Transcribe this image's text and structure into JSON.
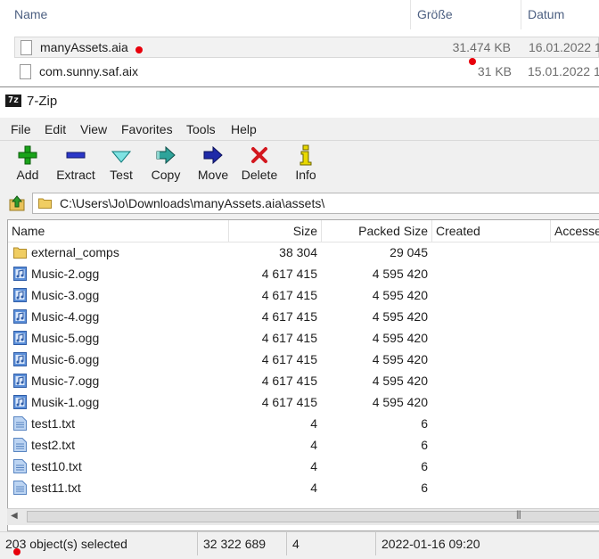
{
  "explorer": {
    "columns": {
      "name": "Name",
      "size": "Größe",
      "date": "Datum"
    },
    "rows": [
      {
        "name": "manyAssets.aia",
        "size": "31.474 KB",
        "date": "16.01.2022 1"
      },
      {
        "name": "com.sunny.saf.aix",
        "size": "31 KB",
        "date": "15.01.2022 1"
      }
    ]
  },
  "window": {
    "title": "7-Zip",
    "app_icon": "7z"
  },
  "menu": [
    "File",
    "Edit",
    "View",
    "Favorites",
    "Tools",
    "Help"
  ],
  "toolbar": {
    "add": "Add",
    "extract": "Extract",
    "test": "Test",
    "copy": "Copy",
    "move": "Move",
    "delete": "Delete",
    "info": "Info"
  },
  "address": {
    "path": "C:\\Users\\Jo\\Downloads\\manyAssets.aia\\assets\\"
  },
  "list": {
    "columns": {
      "name": "Name",
      "size": "Size",
      "packed": "Packed Size",
      "created": "Created",
      "accessed": "Accesse"
    },
    "rows": [
      {
        "name": "external_comps",
        "size": "38 304",
        "packed": "29 045",
        "icon": "folder-icon"
      },
      {
        "name": "Music-2.ogg",
        "size": "4 617 415",
        "packed": "4 595 420",
        "icon": "audio-file-icon"
      },
      {
        "name": "Music-3.ogg",
        "size": "4 617 415",
        "packed": "4 595 420",
        "icon": "audio-file-icon"
      },
      {
        "name": "Music-4.ogg",
        "size": "4 617 415",
        "packed": "4 595 420",
        "icon": "audio-file-icon"
      },
      {
        "name": "Music-5.ogg",
        "size": "4 617 415",
        "packed": "4 595 420",
        "icon": "audio-file-icon"
      },
      {
        "name": "Music-6.ogg",
        "size": "4 617 415",
        "packed": "4 595 420",
        "icon": "audio-file-icon"
      },
      {
        "name": "Music-7.ogg",
        "size": "4 617 415",
        "packed": "4 595 420",
        "icon": "audio-file-icon"
      },
      {
        "name": "Musik-1.ogg",
        "size": "4 617 415",
        "packed": "4 595 420",
        "icon": "audio-file-icon"
      },
      {
        "name": "test1.txt",
        "size": "4",
        "packed": "6",
        "icon": "text-file-icon"
      },
      {
        "name": "test2.txt",
        "size": "4",
        "packed": "6",
        "icon": "text-file-icon"
      },
      {
        "name": "test10.txt",
        "size": "4",
        "packed": "6",
        "icon": "text-file-icon"
      },
      {
        "name": "test11.txt",
        "size": "4",
        "packed": "6",
        "icon": "text-file-icon"
      }
    ]
  },
  "status": {
    "selected": "203 object(s) selected",
    "total_size": "32 322 689",
    "count": "4",
    "date": "2022-01-16 09:20"
  },
  "colors": {
    "marker": "#e8000b",
    "window_bg": "#f0f0f0"
  }
}
